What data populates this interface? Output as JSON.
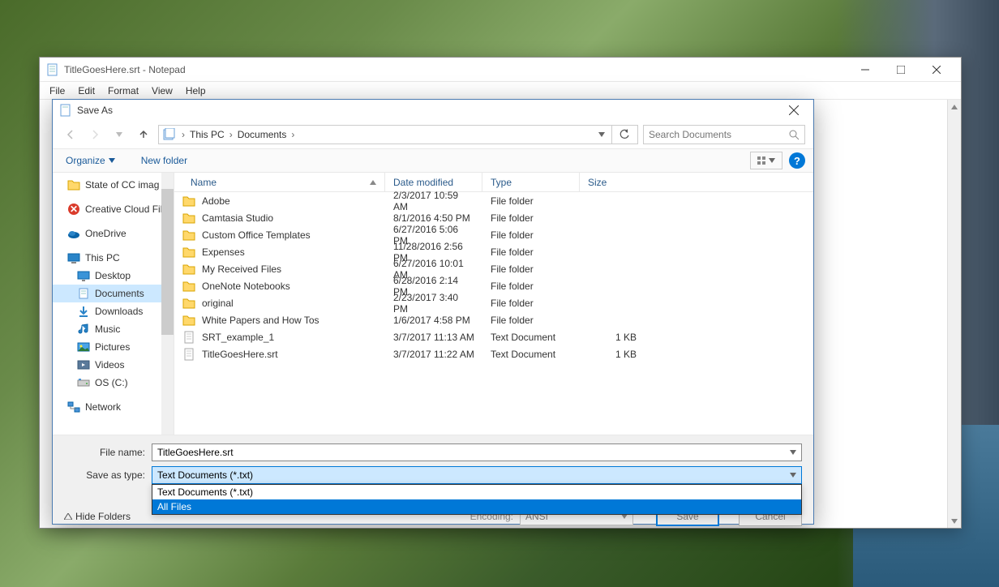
{
  "notepad": {
    "title": "TitleGoesHere.srt - Notepad",
    "menu": {
      "file": "File",
      "edit": "Edit",
      "format": "Format",
      "view": "View",
      "help": "Help"
    }
  },
  "dialog": {
    "title": "Save As",
    "breadcrumb": {
      "root": "This PC",
      "folder": "Documents"
    },
    "search_placeholder": "Search Documents",
    "toolbar": {
      "organize": "Organize",
      "newfolder": "New folder"
    },
    "columns": {
      "name": "Name",
      "date": "Date modified",
      "type": "Type",
      "size": "Size"
    },
    "sidebar": {
      "items": [
        {
          "label": "State of CC imag",
          "icon": "folder"
        },
        {
          "label": "Creative Cloud Fil",
          "icon": "cc"
        },
        {
          "label": "OneDrive",
          "icon": "onedrive"
        },
        {
          "label": "This PC",
          "icon": "pc"
        },
        {
          "label": "Desktop",
          "icon": "desktop",
          "indent": true
        },
        {
          "label": "Documents",
          "icon": "documents",
          "indent": true,
          "selected": true
        },
        {
          "label": "Downloads",
          "icon": "downloads",
          "indent": true
        },
        {
          "label": "Music",
          "icon": "music",
          "indent": true
        },
        {
          "label": "Pictures",
          "icon": "pictures",
          "indent": true
        },
        {
          "label": "Videos",
          "icon": "videos",
          "indent": true
        },
        {
          "label": "OS (C:)",
          "icon": "drive",
          "indent": true
        },
        {
          "label": "Network",
          "icon": "network"
        }
      ]
    },
    "files": [
      {
        "name": "Adobe",
        "date": "2/3/2017 10:59 AM",
        "type": "File folder",
        "size": "",
        "icon": "folder"
      },
      {
        "name": "Camtasia Studio",
        "date": "8/1/2016 4:50 PM",
        "type": "File folder",
        "size": "",
        "icon": "folder"
      },
      {
        "name": "Custom Office Templates",
        "date": "6/27/2016 5:06 PM",
        "type": "File folder",
        "size": "",
        "icon": "folder"
      },
      {
        "name": "Expenses",
        "date": "11/28/2016 2:56 PM",
        "type": "File folder",
        "size": "",
        "icon": "folder"
      },
      {
        "name": "My Received Files",
        "date": "6/27/2016 10:01 AM",
        "type": "File folder",
        "size": "",
        "icon": "folder"
      },
      {
        "name": "OneNote Notebooks",
        "date": "6/28/2016 2:14 PM",
        "type": "File folder",
        "size": "",
        "icon": "folder"
      },
      {
        "name": "original",
        "date": "2/23/2017 3:40 PM",
        "type": "File folder",
        "size": "",
        "icon": "folder"
      },
      {
        "name": "White Papers and How Tos",
        "date": "1/6/2017 4:58 PM",
        "type": "File folder",
        "size": "",
        "icon": "folder"
      },
      {
        "name": "SRT_example_1",
        "date": "3/7/2017 11:13 AM",
        "type": "Text Document",
        "size": "1 KB",
        "icon": "text"
      },
      {
        "name": "TitleGoesHere.srt",
        "date": "3/7/2017 11:22 AM",
        "type": "Text Document",
        "size": "1 KB",
        "icon": "text"
      }
    ],
    "form": {
      "filename_label": "File name:",
      "filename_value": "TitleGoesHere.srt",
      "saveas_label": "Save as type:",
      "saveas_value": "Text Documents (*.txt)",
      "dropdown_options": [
        "Text Documents (*.txt)",
        "All Files"
      ],
      "hide_folders": "Hide Folders",
      "encoding_label": "Encoding:",
      "encoding_value": "ANSI",
      "save": "Save",
      "cancel": "Cancel"
    }
  }
}
